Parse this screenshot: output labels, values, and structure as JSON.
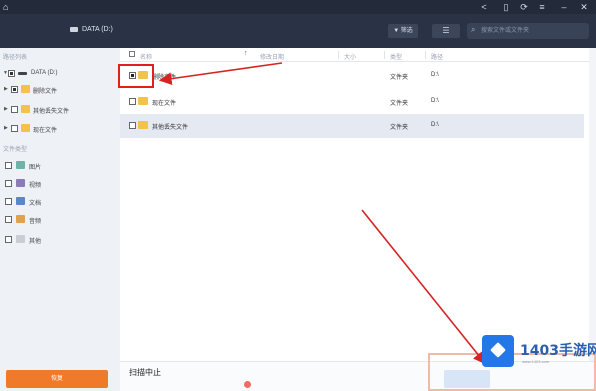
{
  "titlebar": {
    "app_title": "",
    "icons": [
      "home-icon",
      "share-icon",
      "mobile-icon",
      "restore-icon",
      "menu-icon",
      "minimize-icon",
      "close-icon"
    ]
  },
  "toolbar": {
    "drive_label": "DATA (D:)",
    "filter_label": "筛选",
    "search_placeholder": "搜索文件或文件夹"
  },
  "sidebar": {
    "section_path": "路径列表",
    "section_type": "文件类型",
    "tree": [
      {
        "label": "DATA (D:)",
        "count": ""
      },
      {
        "label": "删除文件",
        "count": ""
      },
      {
        "label": "其他丢失文件",
        "count": ""
      },
      {
        "label": "现在文件",
        "count": ""
      }
    ],
    "types": [
      {
        "label": "图片",
        "icon": "image-icon",
        "count": ""
      },
      {
        "label": "视频",
        "icon": "video-icon",
        "count": ""
      },
      {
        "label": "文档",
        "icon": "document-icon",
        "count": ""
      },
      {
        "label": "音频",
        "icon": "audio-icon",
        "count": ""
      },
      {
        "label": "其他",
        "icon": "other-icon",
        "count": ""
      }
    ],
    "recover_label": "恢复"
  },
  "list": {
    "headers": {
      "name": "名称",
      "modified": "修改日期",
      "size": "大小",
      "type": "类型",
      "path": "路径"
    },
    "rows": [
      {
        "name": "删除文件",
        "type": "文件夹",
        "path": "D:\\",
        "checked": true,
        "selected": false
      },
      {
        "name": "现在文件",
        "type": "文件夹",
        "path": "D:\\",
        "checked": false,
        "selected": false
      },
      {
        "name": "其他丢失文件",
        "type": "文件夹",
        "path": "D:\\",
        "checked": false,
        "selected": true
      }
    ]
  },
  "status": {
    "title": "扫描中止",
    "detail": "",
    "time": ""
  },
  "watermark": {
    "brand": "1403手游网",
    "url": "www.1403.com"
  },
  "colors": {
    "titlebar_bg": "#232b3b",
    "toolbar_bg": "#2a3346",
    "sidebar_bg": "#eef1f6",
    "accent_orange": "#f07a2a",
    "annotation_red": "#e02020",
    "selected_row": "#e4e9f2"
  }
}
